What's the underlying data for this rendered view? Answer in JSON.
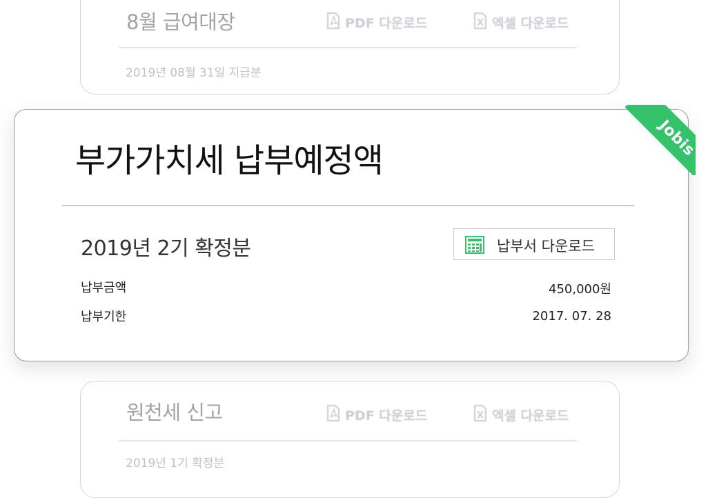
{
  "top_card": {
    "title": "8월 급여대장",
    "pdf_label": "PDF 다운로드",
    "excel_label": "엑셀 다운로드",
    "subtitle": "2019년 08월 31일 지급분"
  },
  "main_card": {
    "title": "부가가치세 납부예정액",
    "period": "2019년 2기 확정분",
    "download_label": "납부서 다운로드",
    "amount_label": "납부금액",
    "amount_value": "450,000원",
    "due_label": "납부기한",
    "due_value": "2017. 07. 28",
    "ribbon_text": "Jobis"
  },
  "bottom_card": {
    "title": "원천세 신고",
    "pdf_label": "PDF 다운로드",
    "excel_label": "엑셀 다운로드",
    "subtitle": "2019년 1기 확정분"
  },
  "colors": {
    "accent_green": "#35c26b",
    "muted_text": "#a3a3a3",
    "faded_action": "#c9ccd2"
  }
}
